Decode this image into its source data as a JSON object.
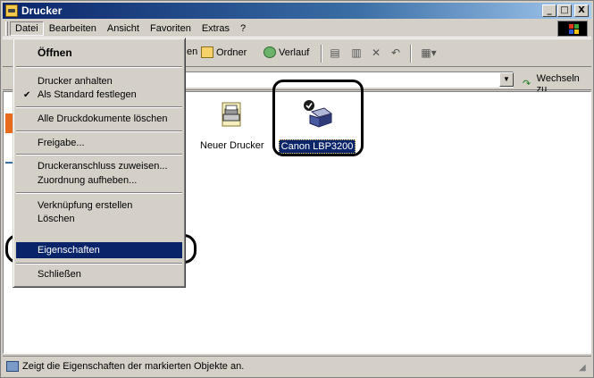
{
  "window": {
    "title": "Drucker",
    "controls": {
      "minimize": "_",
      "maximize": "□",
      "close": "X"
    }
  },
  "menubar": {
    "items": [
      "Datei",
      "Bearbeiten",
      "Ansicht",
      "Favoriten",
      "Extras",
      "?"
    ]
  },
  "toolbar": {
    "partial_label": "en",
    "folders_label": "Ordner",
    "history_label": "Verlauf",
    "extra_icons": [
      "move-to-icon",
      "copy-to-icon",
      "delete-icon",
      "undo-icon",
      "views-icon"
    ]
  },
  "addressbar": {
    "go_label": "Wechseln zu",
    "value": ""
  },
  "content": {
    "items": [
      {
        "label": "Neuer Drucker",
        "icon": "add-printer-icon",
        "selected": false
      },
      {
        "label": "Canon LBP3200",
        "icon": "printer-default-icon",
        "selected": true
      }
    ]
  },
  "file_menu": {
    "items": [
      {
        "label": "Öffnen",
        "bold": true
      },
      {
        "label": "Drucker anhalten"
      },
      {
        "label": "Als Standard festlegen",
        "checked": true,
        "check": "✔"
      },
      {
        "label": "Alle Druckdokumente löschen"
      },
      {
        "label": "Freigabe..."
      },
      {
        "label": "Druckeranschluss zuweisen..."
      },
      {
        "label": "Zuordnung aufheben..."
      },
      {
        "label": "Verknüpfung erstellen"
      },
      {
        "label": "Löschen"
      },
      {
        "label": "Eigenschaften",
        "highlighted": true
      },
      {
        "label": "Schließen"
      }
    ]
  },
  "statusbar": {
    "text": "Zeigt die Eigenschaften der markierten Objekte an."
  },
  "colors": {
    "titlebar": "#0a246a",
    "highlight": "#0a246a",
    "face": "#d4d0c8"
  }
}
